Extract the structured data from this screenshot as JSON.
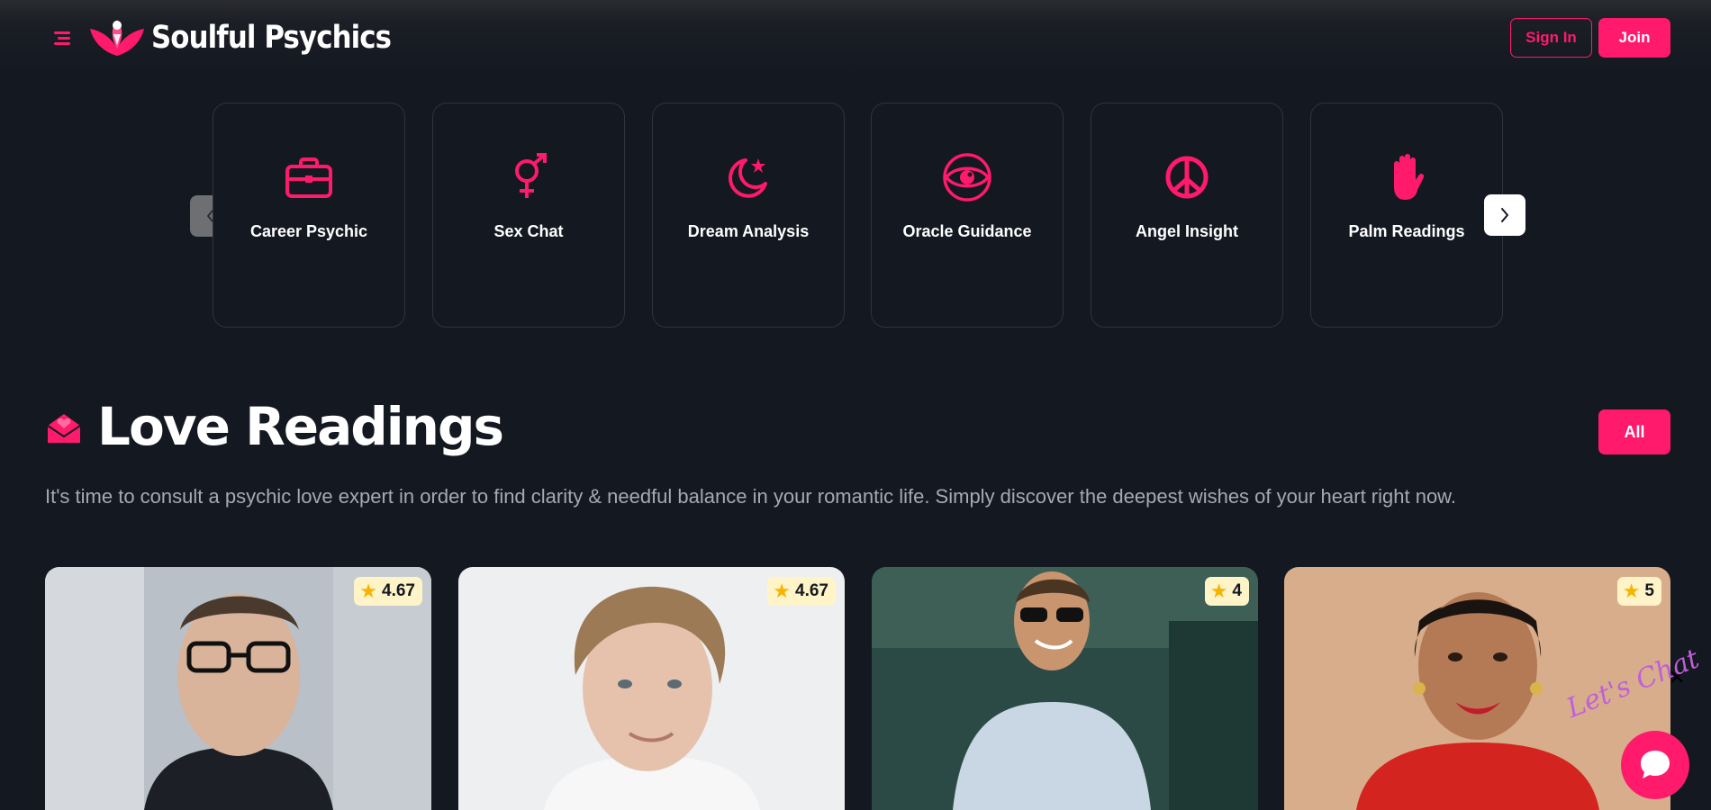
{
  "header": {
    "brand": "Soulful Psychics",
    "signin_label": "Sign In",
    "join_label": "Join"
  },
  "categories": [
    {
      "label": "Career Psychic",
      "icon": "briefcase-icon"
    },
    {
      "label": "Sex Chat",
      "icon": "gender-icon"
    },
    {
      "label": "Dream Analysis",
      "icon": "moon-star-icon"
    },
    {
      "label": "Oracle Guidance",
      "icon": "eye-icon"
    },
    {
      "label": "Angel Insight",
      "icon": "peace-icon"
    },
    {
      "label": "Palm Readings",
      "icon": "hand-icon"
    }
  ],
  "love_section": {
    "title": "Love Readings",
    "all_label": "All",
    "description": "It's time to consult a psychic love expert in order to find clarity & needful balance in your romantic life. Simply discover the deepest wishes of your heart right now."
  },
  "psychics": [
    {
      "rating": "4.67"
    },
    {
      "rating": "4.67"
    },
    {
      "rating": "4"
    },
    {
      "rating": "5"
    }
  ],
  "chat_widget": {
    "label": "Let's Chat",
    "close_glyph": "✕"
  },
  "colors": {
    "accent": "#ff1a6c",
    "background": "#141821",
    "card_border": "#2e3340",
    "muted_text": "#a4a9b3",
    "rating_bg": "#fff4c8"
  }
}
